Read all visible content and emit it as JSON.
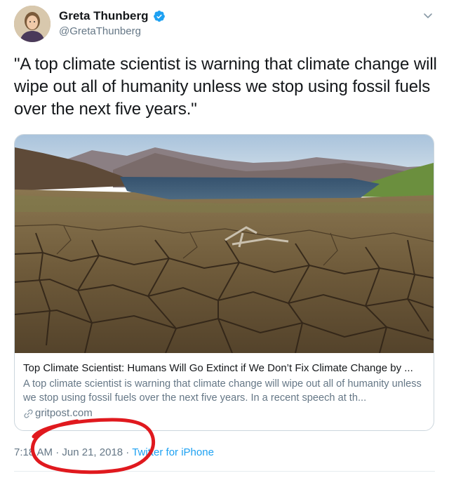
{
  "author": {
    "name": "Greta Thunberg",
    "handle": "@GretaThunberg",
    "verified": true
  },
  "tweet": {
    "text": "\"A top climate scientist is warning that climate change will wipe out all of humanity unless we stop using fossil fuels over the next five years.\""
  },
  "card": {
    "title": "Top Climate Scientist: Humans Will Go Extinct if We Don’t Fix Climate Change by ...",
    "description": "A top climate scientist is warning that climate change will wipe out all of humanity unless we stop using fossil fuels over the next five years. In a recent speech at th...",
    "domain": "gritpost.com"
  },
  "meta": {
    "time": "7:18 AM",
    "separator1": " · ",
    "date": "Jun 21, 2018",
    "separator2": " · ",
    "source": "Twitter for iPhone"
  },
  "colors": {
    "verified": "#1da1f2",
    "link": "#1da1f2",
    "secondary_text": "#657786",
    "annotation": "#e0191e"
  },
  "icons": {
    "verified": "verified-badge-icon",
    "caret": "chevron-down-icon",
    "link": "link-icon"
  }
}
